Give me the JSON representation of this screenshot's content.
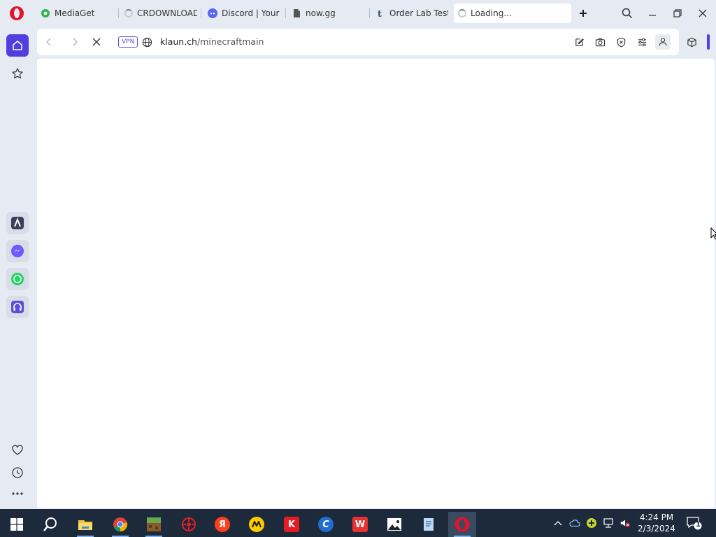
{
  "browser": {
    "tabs": [
      {
        "label": "MediaGet",
        "favicon": "mediaget-icon",
        "state": "normal"
      },
      {
        "label": "CRDOWNLOAD",
        "favicon": "spinner-icon",
        "state": "loading"
      },
      {
        "label": "Discord | Your Pl",
        "favicon": "discord-icon",
        "state": "normal"
      },
      {
        "label": "now.gg",
        "favicon": "document-icon",
        "state": "normal"
      },
      {
        "label": "Order Lab Tests",
        "favicon": "tumblr-icon",
        "state": "normal"
      },
      {
        "label": "Loading...",
        "favicon": "spinner-icon",
        "state": "active"
      }
    ],
    "vpn_label": "VPN",
    "url": {
      "domain": "klaun.ch",
      "path": "/minecraftmain"
    },
    "colors": {
      "accent": "#4f3ee0",
      "brand": "#e2132b"
    }
  },
  "sidebar": {
    "items": [
      {
        "name": "home-icon"
      },
      {
        "name": "star-icon"
      },
      {
        "name": "aria-icon"
      },
      {
        "name": "messenger-icon"
      },
      {
        "name": "whatsapp-icon"
      },
      {
        "name": "music-player-icon"
      },
      {
        "name": "heart-icon"
      },
      {
        "name": "history-icon"
      },
      {
        "name": "more-icon"
      }
    ]
  },
  "taskbar": {
    "apps": [
      {
        "name": "start-icon"
      },
      {
        "name": "search-icon"
      },
      {
        "name": "file-explorer-icon"
      },
      {
        "name": "chrome-icon"
      },
      {
        "name": "minecraft-icon"
      },
      {
        "name": "antivirus-icon"
      },
      {
        "name": "yandex-browser-icon",
        "glyph": "Я"
      },
      {
        "name": "yandex-market-icon"
      },
      {
        "name": "kaspersky-icon",
        "glyph": "K"
      },
      {
        "name": "ccleaner-icon",
        "glyph": "C"
      },
      {
        "name": "wps-office-icon",
        "glyph": "W"
      },
      {
        "name": "photos-icon"
      },
      {
        "name": "notepad-icon"
      },
      {
        "name": "opera-icon"
      }
    ],
    "time": "4:24 PM",
    "date": "2/3/2024",
    "notification_count": "1"
  }
}
